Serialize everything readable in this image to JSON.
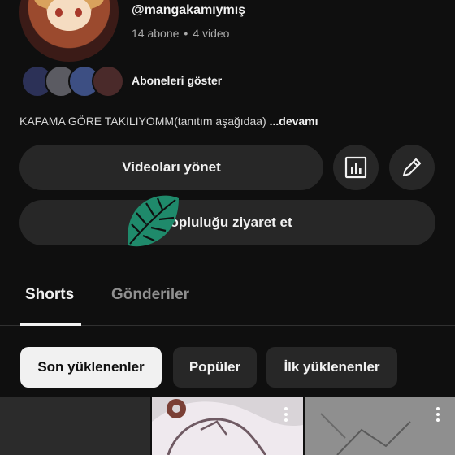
{
  "channel": {
    "handle": "@mangakamıymış",
    "subscribers": "14 abone",
    "separator": "•",
    "videos": "4 video",
    "show_subscribers_label": "Aboneleri göster",
    "description": "KAFAMA GÖRE TAKILIYOMM(tanıtım aşağıdaa)",
    "more_label": "...devamı"
  },
  "actions": {
    "manage_videos_label": "Videoları yönet",
    "community_label": "Topluluğu ziyaret et",
    "analytics_icon": "bar-chart-icon",
    "edit_icon": "pencil-icon"
  },
  "tabs": [
    {
      "label": "Shorts",
      "selected": true
    },
    {
      "label": "Gönderiler",
      "selected": false
    }
  ],
  "filters": [
    {
      "label": "Son yüklenenler",
      "selected": true
    },
    {
      "label": "Popüler",
      "selected": false
    },
    {
      "label": "İlk yüklenenler",
      "selected": false
    }
  ],
  "colors": {
    "background": "#0f0f0f",
    "button": "#272727",
    "text": "#f1f1f1",
    "secondary_text": "#aaaaaa",
    "leaf": "#1f8a6b"
  }
}
